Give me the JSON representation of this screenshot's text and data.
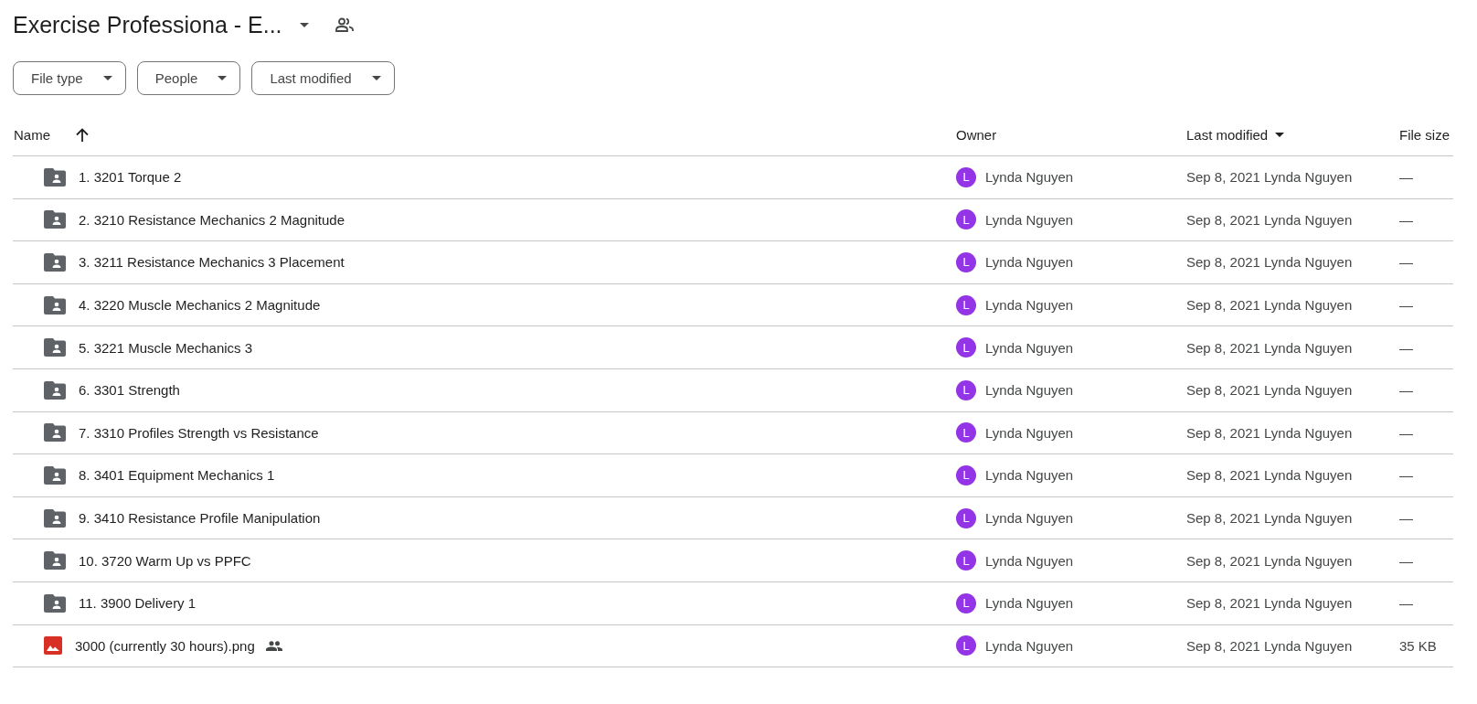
{
  "header": {
    "title": "Exercise Professiona - E..."
  },
  "filters": [
    "File type",
    "People",
    "Last modified"
  ],
  "table": {
    "columns": [
      {
        "label": "Name",
        "sorted": true,
        "ascending": true
      },
      {
        "label": "Owner",
        "sorted": false
      },
      {
        "label": "Last modified",
        "sorted": true,
        "ascending": false
      },
      {
        "label": "File size",
        "sorted": false
      }
    ],
    "rows": [
      {
        "kind": "folder",
        "name": "1. 3201 Torque 2",
        "shared": false,
        "avatar": "L",
        "color": "#9334e6",
        "owner": "Lynda Nguyen",
        "modified": "Sep 8, 2021 Lynda Nguyen",
        "size": "—"
      },
      {
        "kind": "folder",
        "name": "2. 3210 Resistance Mechanics 2 Magnitude",
        "shared": false,
        "avatar": "L",
        "color": "#9334e6",
        "owner": "Lynda Nguyen",
        "modified": "Sep 8, 2021 Lynda Nguyen",
        "size": "—"
      },
      {
        "kind": "folder",
        "name": "3. 3211 Resistance Mechanics 3 Placement",
        "shared": false,
        "avatar": "L",
        "color": "#9334e6",
        "owner": "Lynda Nguyen",
        "modified": "Sep 8, 2021 Lynda Nguyen",
        "size": "—"
      },
      {
        "kind": "folder",
        "name": "4. 3220 Muscle Mechanics 2 Magnitude",
        "shared": false,
        "avatar": "L",
        "color": "#9334e6",
        "owner": "Lynda Nguyen",
        "modified": "Sep 8, 2021 Lynda Nguyen",
        "size": "—"
      },
      {
        "kind": "folder",
        "name": "5. 3221 Muscle Mechanics 3",
        "shared": false,
        "avatar": "L",
        "color": "#9334e6",
        "owner": "Lynda Nguyen",
        "modified": "Sep 8, 2021 Lynda Nguyen",
        "size": "—"
      },
      {
        "kind": "folder",
        "name": "6. 3301 Strength",
        "shared": false,
        "avatar": "L",
        "color": "#9334e6",
        "owner": "Lynda Nguyen",
        "modified": "Sep 8, 2021 Lynda Nguyen",
        "size": "—"
      },
      {
        "kind": "folder",
        "name": "7. 3310 Profiles Strength vs Resistance",
        "shared": false,
        "avatar": "L",
        "color": "#9334e6",
        "owner": "Lynda Nguyen",
        "modified": "Sep 8, 2021 Lynda Nguyen",
        "size": "—"
      },
      {
        "kind": "folder",
        "name": "8. 3401 Equipment Mechanics 1",
        "shared": false,
        "avatar": "L",
        "color": "#9334e6",
        "owner": "Lynda Nguyen",
        "modified": "Sep 8, 2021 Lynda Nguyen",
        "size": "—"
      },
      {
        "kind": "folder",
        "name": "9. 3410 Resistance Profile Manipulation",
        "shared": false,
        "avatar": "L",
        "color": "#9334e6",
        "owner": "Lynda Nguyen",
        "modified": "Sep 8, 2021 Lynda Nguyen",
        "size": "—"
      },
      {
        "kind": "folder",
        "name": "10. 3720 Warm Up vs PPFC",
        "shared": false,
        "avatar": "L",
        "color": "#9334e6",
        "owner": "Lynda Nguyen",
        "modified": "Sep 8, 2021 Lynda Nguyen",
        "size": "—"
      },
      {
        "kind": "folder",
        "name": "11. 3900 Delivery 1",
        "shared": false,
        "avatar": "L",
        "color": "#9334e6",
        "owner": "Lynda Nguyen",
        "modified": "Sep 8, 2021 Lynda Nguyen",
        "size": "—"
      },
      {
        "kind": "image",
        "name": "3000 (currently 30 hours).png",
        "shared": true,
        "avatar": "L",
        "color": "#9334e6",
        "owner": "Lynda Nguyen",
        "modified": "Sep 8, 2021 Lynda Nguyen",
        "size": "35 KB"
      }
    ]
  }
}
